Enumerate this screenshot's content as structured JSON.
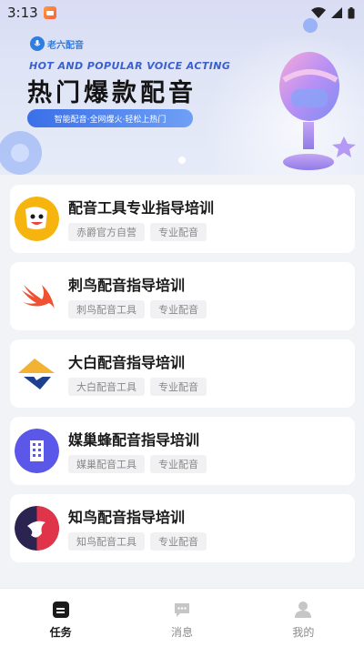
{
  "status_bar": {
    "time": "3:13"
  },
  "banner": {
    "brand_name": "老六配音",
    "subtitle_en": "HOT AND POPULAR VOICE ACTING",
    "title": "热门爆款配音",
    "pill_text": "智能配音·全网爆火·轻松上热门",
    "page_indicator_count": 1
  },
  "courses": [
    {
      "title": "配音工具专业指导培训",
      "tags": [
        "赤爵官方自营",
        "专业配音"
      ],
      "logo": "orange-mascot-logo",
      "logo_color": "#f6b40e"
    },
    {
      "title": "刺鸟配音指导培训",
      "tags": [
        "刺鸟配音工具",
        "专业配音"
      ],
      "logo": "swift-bird-logo",
      "logo_color": "#f05133"
    },
    {
      "title": "大白配音指导培训",
      "tags": [
        "大白配音工具",
        "专业配音"
      ],
      "logo": "dabai-logo",
      "logo_color": "#f2b233"
    },
    {
      "title": "媒巢蜂配音指导培训",
      "tags": [
        "媒巢配音工具",
        "专业配音"
      ],
      "logo": "building-logo",
      "logo_color": "#5b57e8"
    },
    {
      "title": "知鸟配音指导培训",
      "tags": [
        "知鸟配音工具",
        "专业配音"
      ],
      "logo": "zhiniao-logo",
      "logo_color": "#e0344a"
    }
  ],
  "bottom_nav": {
    "items": [
      {
        "label": "任务",
        "icon": "task-icon",
        "active": true
      },
      {
        "label": "消息",
        "icon": "message-icon",
        "active": false
      },
      {
        "label": "我的",
        "icon": "profile-icon",
        "active": false
      }
    ]
  }
}
